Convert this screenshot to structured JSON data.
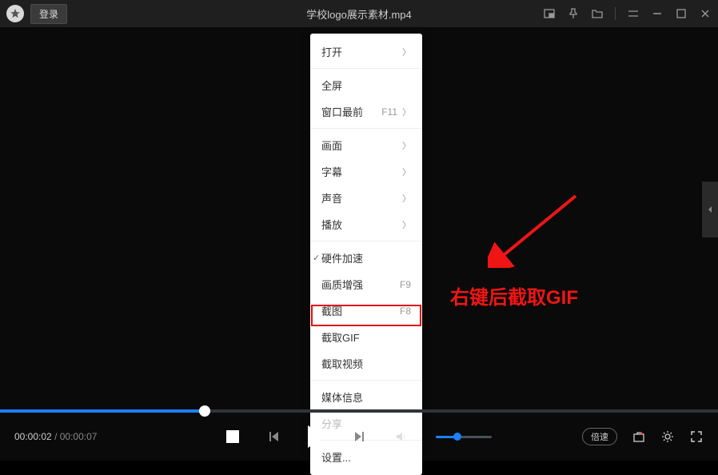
{
  "titlebar": {
    "login": "登录",
    "filename": "学校logo展示素材.mp4"
  },
  "context_menu": {
    "open": "打开",
    "fullscreen": "全屏",
    "always_on_top": "窗口最前",
    "always_on_top_key": "F11",
    "picture": "画面",
    "subtitle": "字幕",
    "audio": "声音",
    "playback": "播放",
    "hw_accel": "硬件加速",
    "enhance": "画质增强",
    "enhance_key": "F9",
    "screenshot": "截图",
    "screenshot_key": "F8",
    "capture_gif": "截取GIF",
    "capture_video": "截取视频",
    "media_info": "媒体信息",
    "share": "分享",
    "settings": "设置..."
  },
  "annotation": {
    "text": "右键后截取GIF"
  },
  "playback": {
    "current": "00:00:02",
    "duration": "00:00:07",
    "speed_label": "倍速"
  }
}
